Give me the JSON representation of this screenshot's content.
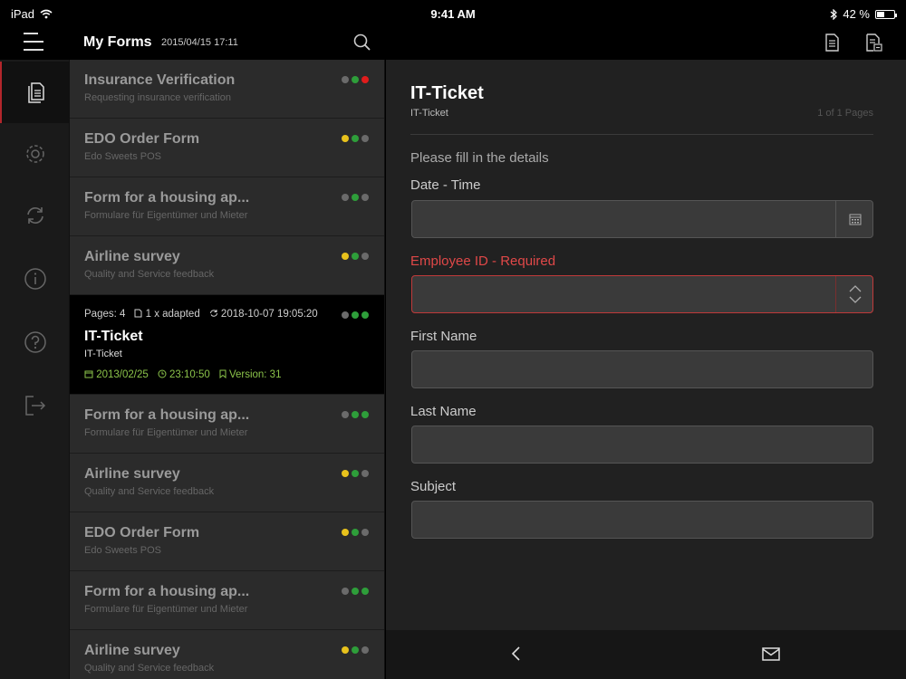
{
  "status_bar": {
    "device": "iPad",
    "time": "9:41 AM",
    "battery": "42 %",
    "battery_level": 0.42
  },
  "nav": {
    "title": "My Forms",
    "datetime": "2015/04/15  17:11"
  },
  "rail": {
    "items": [
      "documents-icon",
      "settings-icon",
      "sync-icon",
      "info-icon",
      "help-icon",
      "logout-icon"
    ]
  },
  "colors": {
    "accent_red": "#b3262b",
    "required_red": "#e04848",
    "dot_grey": "#6b6b6b",
    "dot_green": "#2e9e3a",
    "dot_yellow": "#e8c21c",
    "dot_red": "#e01c1c",
    "meta_green": "#8bc34a"
  },
  "forms": [
    {
      "title": "Insurance Verification",
      "subtitle": "Requesting insurance verification",
      "dots": [
        "grey",
        "green",
        "red"
      ]
    },
    {
      "title": "EDO Order Form",
      "subtitle": "Edo Sweets POS",
      "dots": [
        "yellow",
        "green",
        "grey"
      ]
    },
    {
      "title": "Form for a housing ap...",
      "subtitle": "Formulare für Eigentümer und Mieter",
      "dots": [
        "grey",
        "green",
        "grey"
      ]
    },
    {
      "title": "Airline survey",
      "subtitle": "Quality and Service feedback",
      "dots": [
        "yellow",
        "green",
        "grey"
      ]
    },
    {
      "title": "Form for a housing ap...",
      "subtitle": "Formulare für Eigentümer und Mieter",
      "dots": [
        "grey",
        "green",
        "green"
      ]
    },
    {
      "title": "Airline survey",
      "subtitle": "Quality and Service feedback",
      "dots": [
        "yellow",
        "green",
        "grey"
      ]
    },
    {
      "title": "EDO Order Form",
      "subtitle": "Edo Sweets POS",
      "dots": [
        "yellow",
        "green",
        "grey"
      ]
    },
    {
      "title": "Form for a housing ap...",
      "subtitle": "Formulare für Eigentümer und Mieter",
      "dots": [
        "grey",
        "green",
        "green"
      ]
    },
    {
      "title": "Airline survey",
      "subtitle": "Quality and Service feedback",
      "dots": [
        "yellow",
        "green",
        "grey"
      ]
    }
  ],
  "selected_form": {
    "pages": "Pages: 4",
    "adapted": "1 x adapted",
    "sync_time": "2018-10-07 19:05:20",
    "title": "IT-Ticket",
    "subtitle": "IT-Ticket",
    "date": "2013/02/25",
    "time": "23:10:50",
    "version": "Version: 31",
    "dots": [
      "grey",
      "green",
      "green"
    ]
  },
  "detail": {
    "title": "IT-Ticket",
    "subtitle": "IT-Ticket",
    "pages": "1 of 1 Pages",
    "hint": "Please fill in the details",
    "fields": [
      {
        "label": "Date - Time",
        "value": "",
        "placeholder": "",
        "addon": "calendar-icon"
      },
      {
        "label": "Employee ID - Required",
        "value": "",
        "placeholder": "",
        "addon": "stepper-icon",
        "required": true
      },
      {
        "label": "First Name",
        "value": "",
        "placeholder": ""
      },
      {
        "label": "Last Name",
        "value": "",
        "placeholder": ""
      },
      {
        "label": "Subject",
        "value": "",
        "placeholder": ""
      }
    ]
  },
  "bottom_bar": {
    "items": [
      "back-icon",
      "mail-icon"
    ]
  }
}
